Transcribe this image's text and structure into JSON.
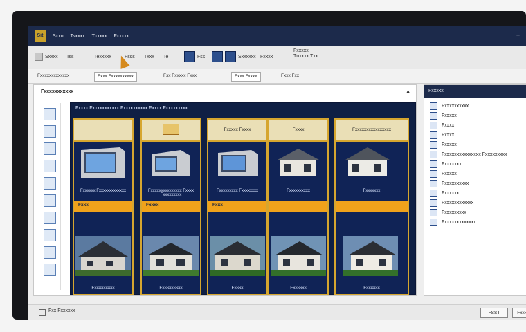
{
  "titlebar": {
    "app_short": "Sit",
    "menu": [
      "Sxxo",
      "Tsxxxx",
      "Txxxxx",
      "Fxxxxx"
    ],
    "min": "=",
    "close": "\\|"
  },
  "ribbon": {
    "items": [
      "Sxxxx",
      "Tss",
      "Texxxxx",
      "Fsss",
      "Txxx",
      "Te",
      "Fss",
      "Sxxxxxx",
      "Fxxxx"
    ],
    "right_label_1": "Fxxxxx",
    "right_label_2": "Tnxxxx Txx"
  },
  "toolbar2": {
    "field1": "Fxxxxxxxxxxxxx",
    "field2": "Fxxx Fxxxxxxxxxx",
    "field3": "Fsx Fxxxxx Fxxx",
    "field4": "Fxxx Fxxxx",
    "field5": "Fxxx Fxx"
  },
  "leftpanel": {
    "title": "Fxxxxxxxxxxx",
    "catalog_heading": "Fxxxx Fxxxxxxxxxxx Fxxxxxxxxxx Fxxxx Fxxxxxxxxx",
    "columns": [
      {
        "header": "",
        "caption1": "Fxxxxxx Fxxxxxxxxxxxxx",
        "band": "Fxxx",
        "caption2": "Fxxxxxxxxx"
      },
      {
        "header": "",
        "caption1": "Fxxxxxxxxxxxxxxx Fxxxx Fxxxxxxxxx",
        "band": "Fxxxx",
        "caption2": "Fxxxxxxxxx"
      },
      {
        "header": "Fxxxxx Fxxxx",
        "caption1": "Fxxxxxxxxx Fxxxxxxxx",
        "band": "Fxxx",
        "caption2": "Fxxxx"
      },
      {
        "header": "Fxxxx",
        "caption1": "Fxxxxxxxxxx",
        "band": "",
        "caption2": "Fxxxxxx"
      },
      {
        "header": "Fxxxxxxxxxxxxxxxx",
        "caption1": "Fxxxxxxx",
        "band": "",
        "caption2": "Fxxxxxx"
      }
    ]
  },
  "rightpanel": {
    "title": "Fxxxxx",
    "items": [
      "Fxxxxxxxxxx",
      "Fxxxxx",
      "Fxxxx",
      "Fxxxx",
      "Fxxxxx",
      "Fxxxxxxxxxxxxxxx Fxxxxxxxxx",
      "Fxxxxxxx",
      "Fxxxxx",
      "Fxxxxxxxxxx",
      "Fxxxxxx",
      "Fxxxxxxxxxxxx",
      "Fxxxxxxxxx",
      "Fxxxxxxxxxxxxx"
    ]
  },
  "statusbar": {
    "text": "Fxx Fxxxxxx",
    "button1": "FSST",
    "button2": "Fxxxxxx"
  },
  "colors": {
    "navy": "#1c2a4b",
    "accent_gold": "#d6a62f",
    "band_orange": "#f0a21b"
  }
}
